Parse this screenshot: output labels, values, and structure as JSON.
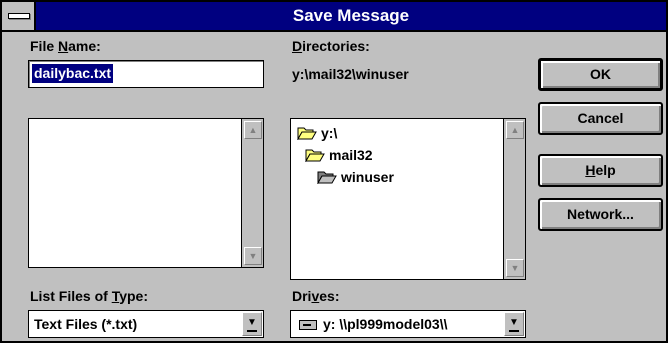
{
  "window": {
    "title": "Save Message"
  },
  "file_name": {
    "label_pre": "File ",
    "label_key": "N",
    "label_post": "ame:",
    "value": "dailybac.txt"
  },
  "directories": {
    "label_key": "D",
    "label_post": "irectories:",
    "current_path": "y:\\mail32\\winuser",
    "tree": [
      {
        "name": "y:\\",
        "icon": "open-folder-icon"
      },
      {
        "name": "mail32",
        "icon": "open-folder-icon"
      },
      {
        "name": "winuser",
        "icon": "open-folder-selected-icon"
      }
    ]
  },
  "file_type": {
    "label_pre": "List Files of ",
    "label_key": "T",
    "label_post": "ype:",
    "selected": "Text Files (*.txt)"
  },
  "drives": {
    "label_pre": "Dri",
    "label_key": "v",
    "label_post": "es:",
    "selected": "y: \\\\pl999model03\\\\"
  },
  "buttons": {
    "ok": "OK",
    "cancel": "Cancel",
    "help_key": "H",
    "help_post": "elp",
    "network": "Network..."
  },
  "colors": {
    "titlebar": "#000080",
    "face": "#c0c0c0",
    "selection": "#000080"
  }
}
